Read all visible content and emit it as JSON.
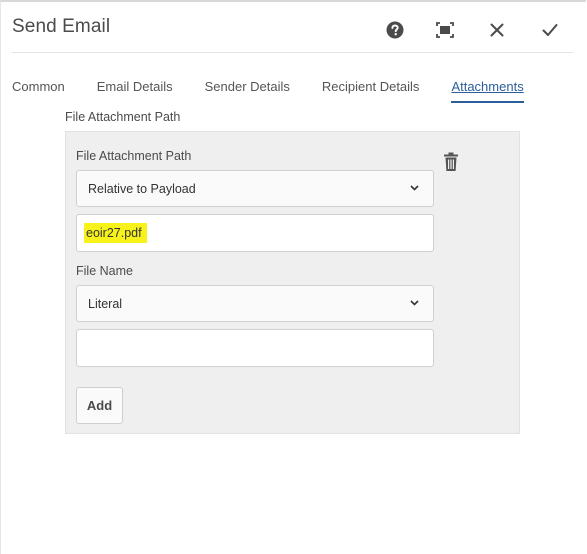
{
  "dialog": {
    "title": "Send Email"
  },
  "header_actions": [
    {
      "name": "help-icon"
    },
    {
      "name": "fullscreen-icon"
    },
    {
      "name": "close-icon"
    },
    {
      "name": "checkmark-icon"
    }
  ],
  "tabs": [
    {
      "label": "Common",
      "active": false
    },
    {
      "label": "Email Details",
      "active": false
    },
    {
      "label": "Sender Details",
      "active": false
    },
    {
      "label": "Recipient Details",
      "active": false
    },
    {
      "label": "Attachments",
      "active": true
    }
  ],
  "attachments": {
    "section_label": "File Attachment Path",
    "item": {
      "path_label": "File Attachment Path",
      "path_type": "Relative to Payload",
      "path_value": "eoir27.pdf",
      "file_name_label": "File Name",
      "file_name_type": "Literal",
      "file_name_value": ""
    },
    "add_label": "Add"
  },
  "colors": {
    "accent": "#2c5e9c",
    "highlight": "#f7f21a",
    "panel_bg": "#efefef"
  }
}
